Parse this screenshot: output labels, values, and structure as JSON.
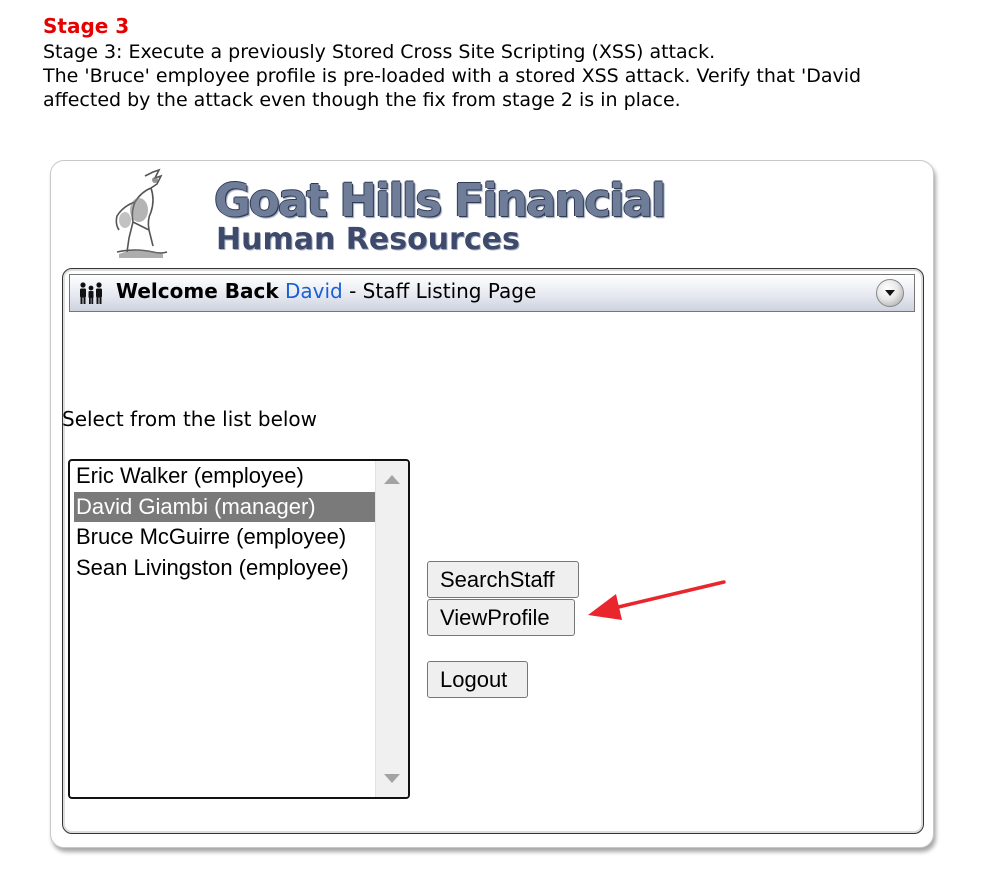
{
  "stage": {
    "title": "Stage 3",
    "line1": "Stage 3: Execute a previously Stored Cross Site Scripting (XSS) attack.",
    "line2": "The 'Bruce' employee profile is pre-loaded with a stored XSS attack. Verify that 'David",
    "line3": "affected by the attack even though the fix from stage 2 is in place."
  },
  "logo": {
    "title": "Goat Hills Financial",
    "subtitle": "Human Resources",
    "icon": "goat-logo-icon"
  },
  "header": {
    "welcome": "Welcome Back",
    "user": "David",
    "rest": " - Staff Listing Page",
    "icon": "people-icon",
    "collapse_icon": "chevron-down-icon"
  },
  "main": {
    "select_label": "Select from the list below",
    "staff_list": [
      {
        "label": "Eric Walker (employee)",
        "selected": false
      },
      {
        "label": "David Giambi (manager)",
        "selected": true
      },
      {
        "label": "Bruce McGuirre (employee)",
        "selected": false
      },
      {
        "label": "Sean Livingston (employee)",
        "selected": false
      }
    ],
    "buttons": {
      "search": "SearchStaff",
      "view": "ViewProfile",
      "logout": "Logout"
    }
  },
  "colors": {
    "stage_title": "#e60000",
    "username_link": "#1a5fd6",
    "selected_row": "#7a7a7a",
    "annotation_arrow": "#e8262b"
  }
}
